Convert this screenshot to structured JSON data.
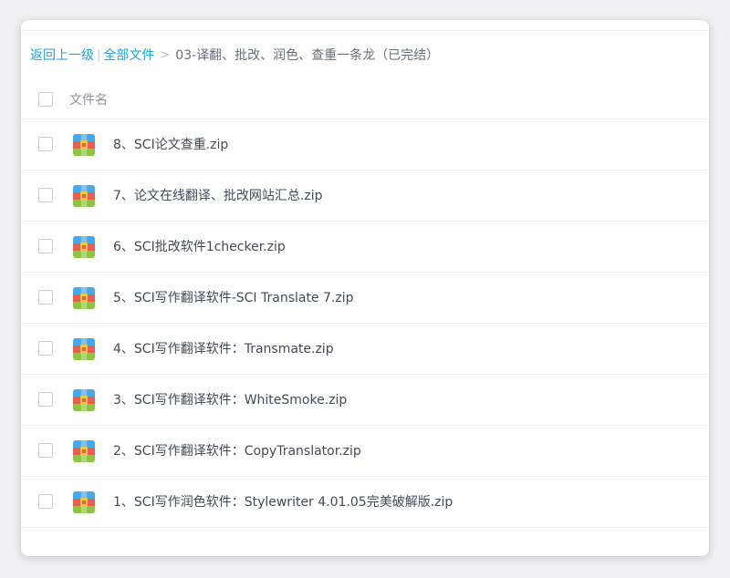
{
  "breadcrumb": {
    "back_label": "返回上一级",
    "divider": "|",
    "all_files_label": "全部文件",
    "separator": ">",
    "current_folder": "03-译翻、批改、润色、查重一条龙（已完结）"
  },
  "list_header": {
    "filename_label": "文件名"
  },
  "files": [
    {
      "name": "8、SCI论文查重.zip",
      "icon": "zip-archive-icon"
    },
    {
      "name": "7、论文在线翻译、批改网站汇总.zip",
      "icon": "zip-archive-icon"
    },
    {
      "name": "6、SCI批改软件1checker.zip",
      "icon": "zip-archive-icon"
    },
    {
      "name": "5、SCI写作翻译软件-SCI Translate 7.zip",
      "icon": "zip-archive-icon"
    },
    {
      "name": "4、SCI写作翻译软件：Transmate.zip",
      "icon": "zip-archive-icon"
    },
    {
      "name": "3、SCI写作翻译软件：WhiteSmoke.zip",
      "icon": "zip-archive-icon"
    },
    {
      "name": "2、SCI写作翻译软件：CopyTranslator.zip",
      "icon": "zip-archive-icon"
    },
    {
      "name": "1、SCI写作润色软件：Stylewriter 4.01.05完美破解版.zip",
      "icon": "zip-archive-icon"
    }
  ],
  "colors": {
    "link": "#1ba3e3",
    "text": "#424a57",
    "zip_blue": "#45a8ea",
    "zip_red": "#e8604c",
    "zip_green": "#8cc63f",
    "zip_latch": "#f4c542"
  }
}
